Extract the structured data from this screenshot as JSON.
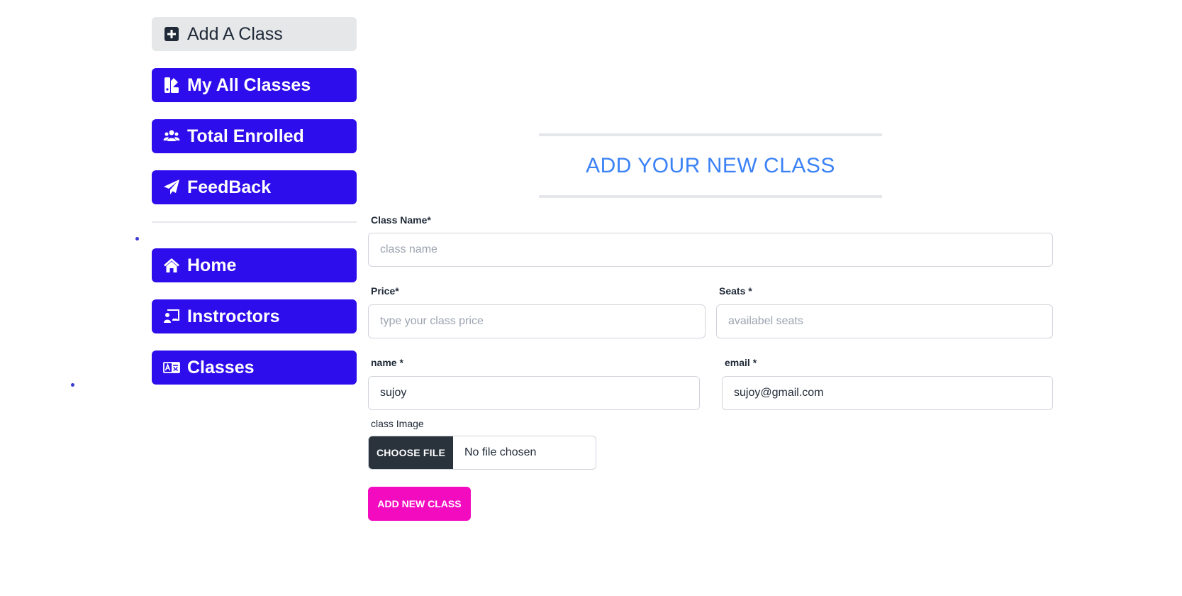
{
  "sidebar": {
    "items": [
      {
        "label": "Add A Class",
        "icon": "plus-square-icon",
        "active": true
      },
      {
        "label": "My All Classes",
        "icon": "swatchbook-icon",
        "active": false
      },
      {
        "label": "Total Enrolled",
        "icon": "users-icon",
        "active": false
      },
      {
        "label": "FeedBack",
        "icon": "paper-plane-icon",
        "active": false
      }
    ],
    "public_items": [
      {
        "label": "Home",
        "icon": "home-icon"
      },
      {
        "label": "Instroctors",
        "icon": "chalkboard-teacher-icon"
      },
      {
        "label": "Classes",
        "icon": "language-icon"
      }
    ]
  },
  "form": {
    "heading": "ADD YOUR NEW CLASS",
    "class_name": {
      "label": "Class Name*",
      "placeholder": "class name",
      "value": ""
    },
    "price": {
      "label": "Price*",
      "placeholder": "type your class price",
      "value": ""
    },
    "seats": {
      "label": "Seats *",
      "placeholder": "availabel seats",
      "value": ""
    },
    "name": {
      "label": "name *",
      "value": "sujoy"
    },
    "email": {
      "label": "email *",
      "value": "sujoy@gmail.com"
    },
    "image": {
      "label": "class Image",
      "button": "CHOOSE FILE",
      "status": "No file chosen"
    },
    "submit": "ADD NEW CLASS"
  },
  "colors": {
    "primary": "#2d0deb",
    "active_bg": "#e6e7e9",
    "heading": "#3b82f6",
    "submit": "#f30bc0",
    "file_button": "#2a323c"
  }
}
